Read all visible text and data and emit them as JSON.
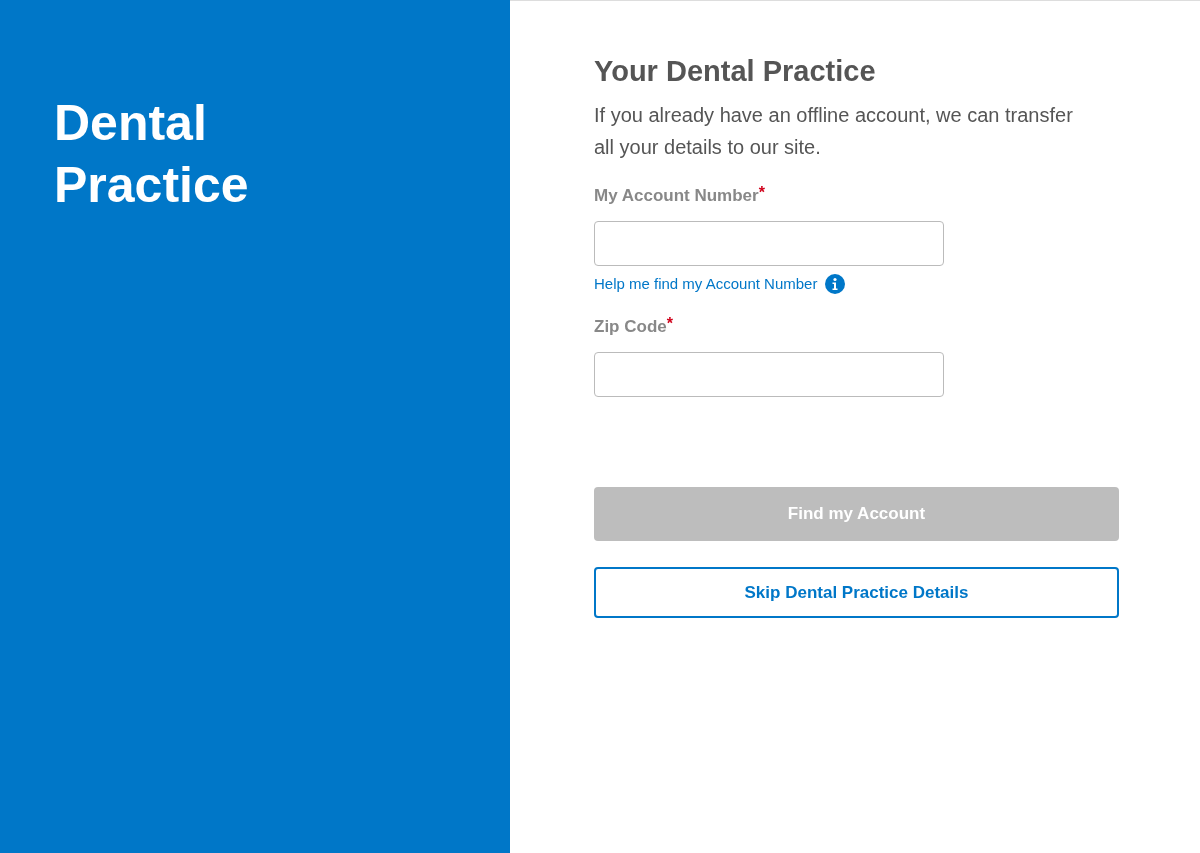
{
  "brand_panel": {
    "title": "Dental Practice"
  },
  "form": {
    "heading": "Your Dental Practice",
    "intro": "If you already have an offline account, we can transfer all your details to our site.",
    "fields": [
      {
        "label": "My Account Number",
        "required_mark": "*",
        "help_link": "Help me find my Account Number"
      },
      {
        "label": "Zip Code",
        "required_mark": "*"
      }
    ],
    "buttons": [
      {
        "kind": "primary",
        "label": "Find my Account",
        "disabled": true
      },
      {
        "kind": "outline",
        "label": "Skip Dental Practice Details",
        "disabled": false
      }
    ]
  }
}
